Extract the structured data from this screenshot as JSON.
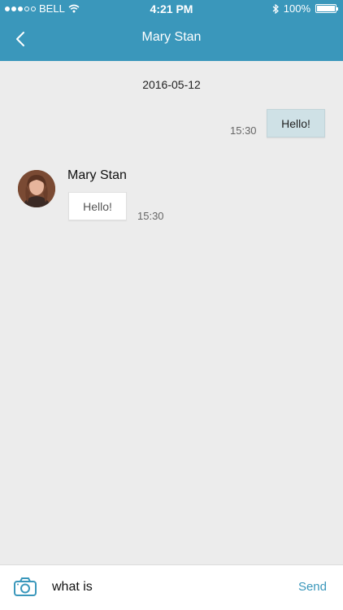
{
  "status_bar": {
    "carrier": "BELL",
    "time": "4:21 PM",
    "battery": "100%",
    "signal_bars_filled": 3,
    "signal_bars_total": 5
  },
  "nav": {
    "title": "Mary Stan",
    "back_icon": "chevron-left-icon"
  },
  "chat": {
    "date": "2016-05-12",
    "messages": [
      {
        "direction": "outgoing",
        "text": "Hello!",
        "time": "15:30"
      },
      {
        "direction": "incoming",
        "sender": "Mary Stan",
        "text": "Hello!",
        "time": "15:30"
      }
    ]
  },
  "composer": {
    "camera_icon": "camera-icon",
    "input_value": "what is",
    "send_label": "Send"
  },
  "colors": {
    "header": "#3a97bb",
    "background": "#ececec",
    "outgoing_bubble": "#cfe1e6",
    "incoming_bubble": "#ffffff",
    "accent": "#3a97bb"
  }
}
